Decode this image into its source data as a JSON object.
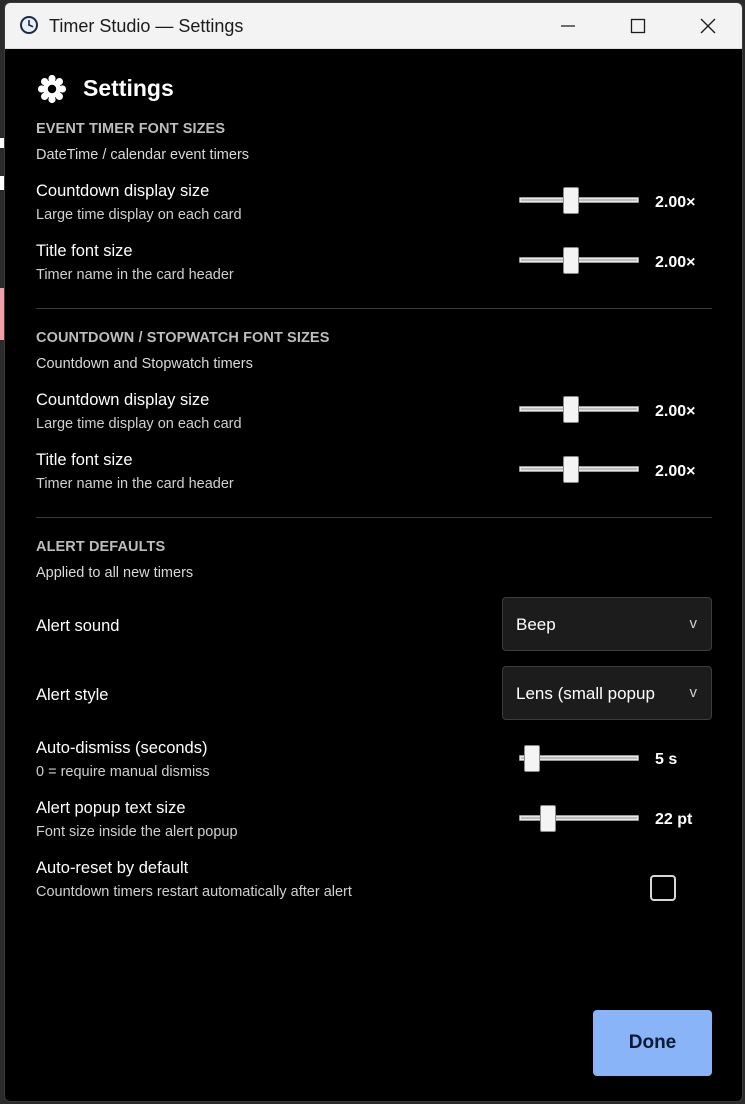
{
  "window": {
    "title": "Timer Studio — Settings"
  },
  "header": {
    "title": "Settings",
    "icon": "gear-icon"
  },
  "sections": [
    {
      "title": "EVENT TIMER FONT SIZES",
      "subtitle": "DateTime / calendar event timers",
      "rows": [
        {
          "label": "Countdown display size",
          "sub": "Large time display on each card",
          "value_text": "2.00×",
          "level": 0.42
        },
        {
          "label": "Title font size",
          "sub": "Timer name in the card header",
          "value_text": "2.00×",
          "level": 0.42
        }
      ]
    },
    {
      "title": "COUNTDOWN / STOPWATCH FONT SIZES",
      "subtitle": "Countdown and Stopwatch timers",
      "rows": [
        {
          "label": "Countdown display size",
          "sub": "Large time display on each card",
          "value_text": "2.00×",
          "level": 0.42
        },
        {
          "label": "Title font size",
          "sub": "Timer name in the card header",
          "value_text": "2.00×",
          "level": 0.42
        }
      ]
    },
    {
      "title": "ALERT DEFAULTS",
      "subtitle": "Applied to all new timers",
      "alert_sound": {
        "label": "Alert sound",
        "value": "Beep"
      },
      "alert_style": {
        "label": "Alert style",
        "value": "Lens (small popup"
      },
      "auto_dismiss": {
        "label": "Auto-dismiss (seconds)",
        "sub": "0 = require manual dismiss",
        "value_text": "5 s",
        "level": 0.05
      },
      "popup_text": {
        "label": "Alert popup text size",
        "sub": "Font size inside the alert popup",
        "value_text": "22 pt",
        "level": 0.2
      },
      "auto_reset": {
        "label": "Auto-reset by default",
        "sub": "Countdown timers restart automatically after alert",
        "checked": false
      }
    }
  ],
  "select_arrow": "v",
  "done_label": "Done",
  "colors": {
    "background": "#000000",
    "titlebar": "#f3f3f3",
    "accent": "#8ab4f8",
    "section_title": "#bdbdbd"
  }
}
